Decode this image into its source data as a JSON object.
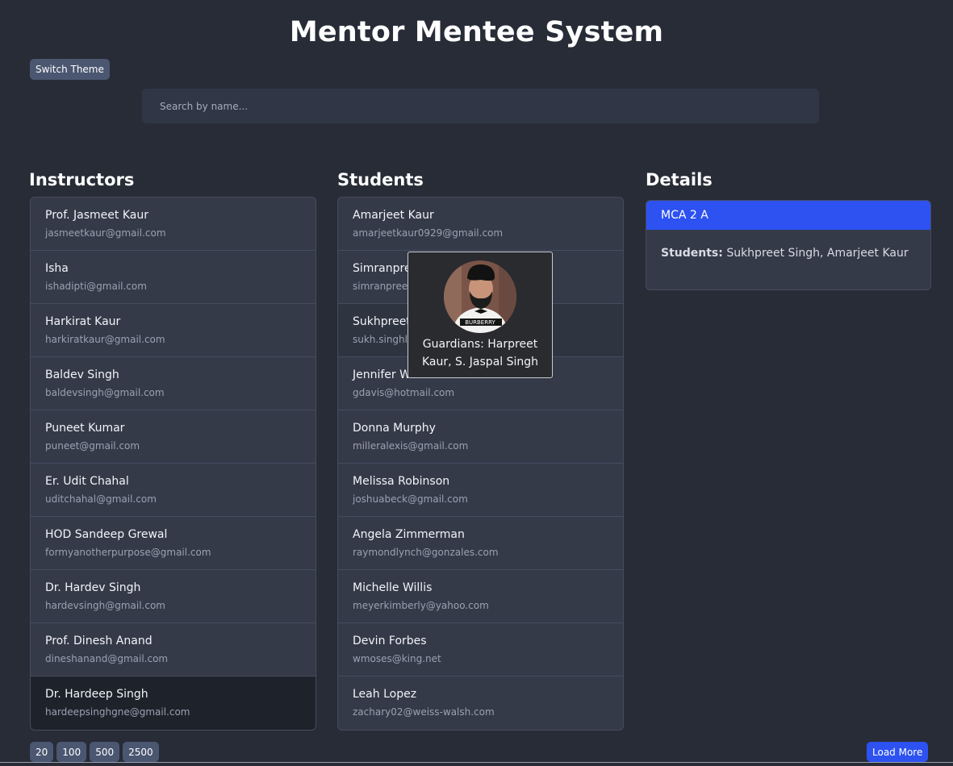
{
  "app": {
    "title": "Mentor Mentee System",
    "theme_button": "Switch Theme"
  },
  "search": {
    "placeholder": "Search by name..."
  },
  "instructors": {
    "heading": "Instructors",
    "items": [
      {
        "name": "Prof. Jasmeet Kaur",
        "email": "jasmeetkaur@gmail.com"
      },
      {
        "name": "Isha",
        "email": "ishadipti@gmail.com"
      },
      {
        "name": "Harkirat Kaur",
        "email": "harkiratkaur@gmail.com"
      },
      {
        "name": "Baldev Singh",
        "email": "baldevsingh@gmail.com"
      },
      {
        "name": "Puneet Kumar",
        "email": "puneet@gmail.com"
      },
      {
        "name": "Er. Udit Chahal",
        "email": "uditchahal@gmail.com"
      },
      {
        "name": "HOD Sandeep Grewal",
        "email": "formyanotherpurpose@gmail.com"
      },
      {
        "name": "Dr. Hardev Singh",
        "email": "hardevsingh@gmail.com"
      },
      {
        "name": "Prof. Dinesh Anand",
        "email": "dineshanand@gmail.com"
      },
      {
        "name": "Dr. Hardeep Singh",
        "email": "hardeepsinghgne@gmail.com"
      }
    ]
  },
  "students": {
    "heading": "Students",
    "items": [
      {
        "name": "Amarjeet Kaur",
        "email": "amarjeetkaur0929@gmail.com"
      },
      {
        "name": "Simranpreet Singh",
        "email": "simranpreet19@gmail.com"
      },
      {
        "name": "Sukhpreet Singh",
        "email": "sukh.singhlotay@gmail.com"
      },
      {
        "name": "Jennifer Werner",
        "email": "gdavis@hotmail.com"
      },
      {
        "name": "Donna Murphy",
        "email": "milleralexis@gmail.com"
      },
      {
        "name": "Melissa Robinson",
        "email": "joshuabeck@gmail.com"
      },
      {
        "name": "Angela Zimmerman",
        "email": "raymondlynch@gonzales.com"
      },
      {
        "name": "Michelle Willis",
        "email": "meyerkimberly@yahoo.com"
      },
      {
        "name": "Devin Forbes",
        "email": "wmoses@king.net"
      },
      {
        "name": "Leah Lopez",
        "email": "zachary02@weiss-walsh.com"
      }
    ]
  },
  "details": {
    "heading": "Details",
    "group": "MCA 2 A",
    "students_label": "Students:",
    "students_value": "Sukhpreet Singh, Amarjeet Kaur"
  },
  "popup": {
    "guardians": "Guardians: Harpreet Kaur, S. Jaspal Singh",
    "shirt_text": "BURBERRY"
  },
  "pager": {
    "options": [
      "20",
      "100",
      "500",
      "2500"
    ],
    "load_more": "Load More"
  },
  "colors": {
    "background": "#282c37",
    "accent": "#2d52f1",
    "card": "#353a49",
    "button": "#4b5670"
  }
}
